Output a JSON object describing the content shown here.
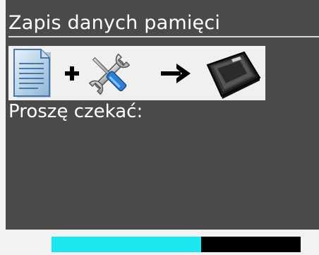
{
  "dialog": {
    "title": "Zapis danych pamięci",
    "message": "Proszę czekać:"
  },
  "icons": [
    "document-icon",
    "plus-icon",
    "tools-icon",
    "arrow-right-icon",
    "memory-device-icon"
  ],
  "progress": {
    "fraction": 0.6
  },
  "colors": {
    "background": "#4a4a4a",
    "progress_fill": "#1ee6f0",
    "progress_track": "#000000",
    "frame": "#f2f2f2"
  }
}
